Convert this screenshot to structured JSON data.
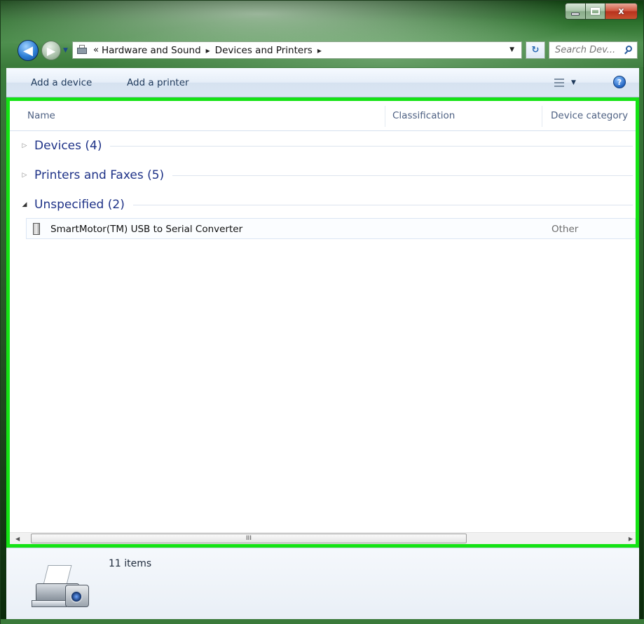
{
  "window": {
    "minimize_label": "",
    "maximize_label": "",
    "close_label": "x"
  },
  "nav": {
    "back_glyph": "◀",
    "forward_glyph": "▶",
    "breadcrumb_overflow": "«",
    "breadcrumbs": [
      "Hardware and Sound",
      "Devices and Printers"
    ],
    "separator": "▸",
    "refresh_glyph": "↻",
    "search_placeholder": "Search Dev..."
  },
  "commands": {
    "add_device": "Add a device",
    "add_printer": "Add a printer",
    "help": "?"
  },
  "columns": {
    "name": "Name",
    "classification": "Classification",
    "device_category": "Device category"
  },
  "groups": [
    {
      "label": "Devices (4)",
      "expanded": false
    },
    {
      "label": "Printers and Faxes (5)",
      "expanded": false
    },
    {
      "label": "Unspecified (2)",
      "expanded": true
    }
  ],
  "group_arrows": {
    "collapsed": "▷",
    "expanded": "◢"
  },
  "devices": [
    {
      "name": "SmartMotor(TM) USB to Serial Converter",
      "classification": "",
      "category": "Other"
    }
  ],
  "scrollbar": {
    "left": "◀",
    "right": "▶",
    "grip": "III"
  },
  "details": {
    "count": "11 items"
  },
  "colors": {
    "accent_frame": "#14e314",
    "group_text": "#1e3287",
    "window_chrome": "#2b6f2b"
  }
}
